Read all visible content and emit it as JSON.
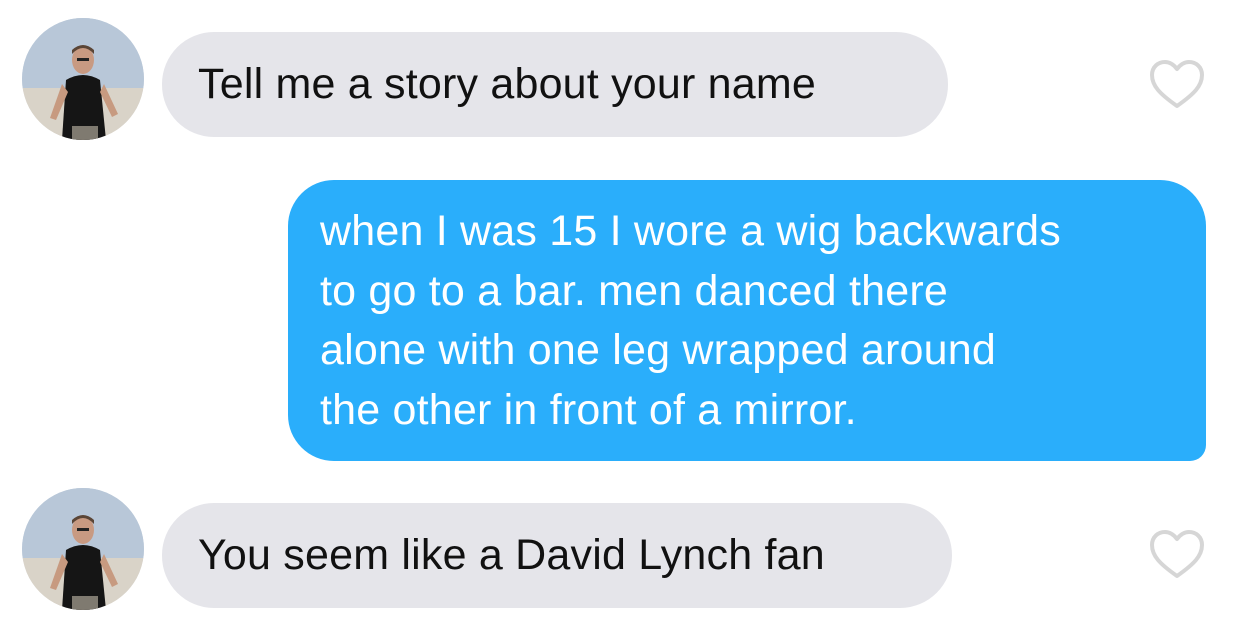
{
  "messages": [
    {
      "direction": "received",
      "text": "Tell me a story about your name",
      "has_avatar": true,
      "liked": false
    },
    {
      "direction": "sent",
      "lines": [
        "when I was 15 I wore a wig backwards",
        "to go to a bar.  men danced there",
        "alone with one leg wrapped around",
        "the other in front of a mirror."
      ]
    },
    {
      "direction": "received",
      "text": "You seem like a David Lynch fan",
      "has_avatar": true,
      "liked": false
    }
  ],
  "icons": {
    "like": "heart-outline-icon",
    "avatar": "profile-photo"
  },
  "colors": {
    "received_bubble": "#e5e5ea",
    "sent_bubble": "#2aaefb",
    "sent_text": "#ffffff",
    "received_text": "#111111",
    "heart_outline": "#d6d6d6"
  }
}
